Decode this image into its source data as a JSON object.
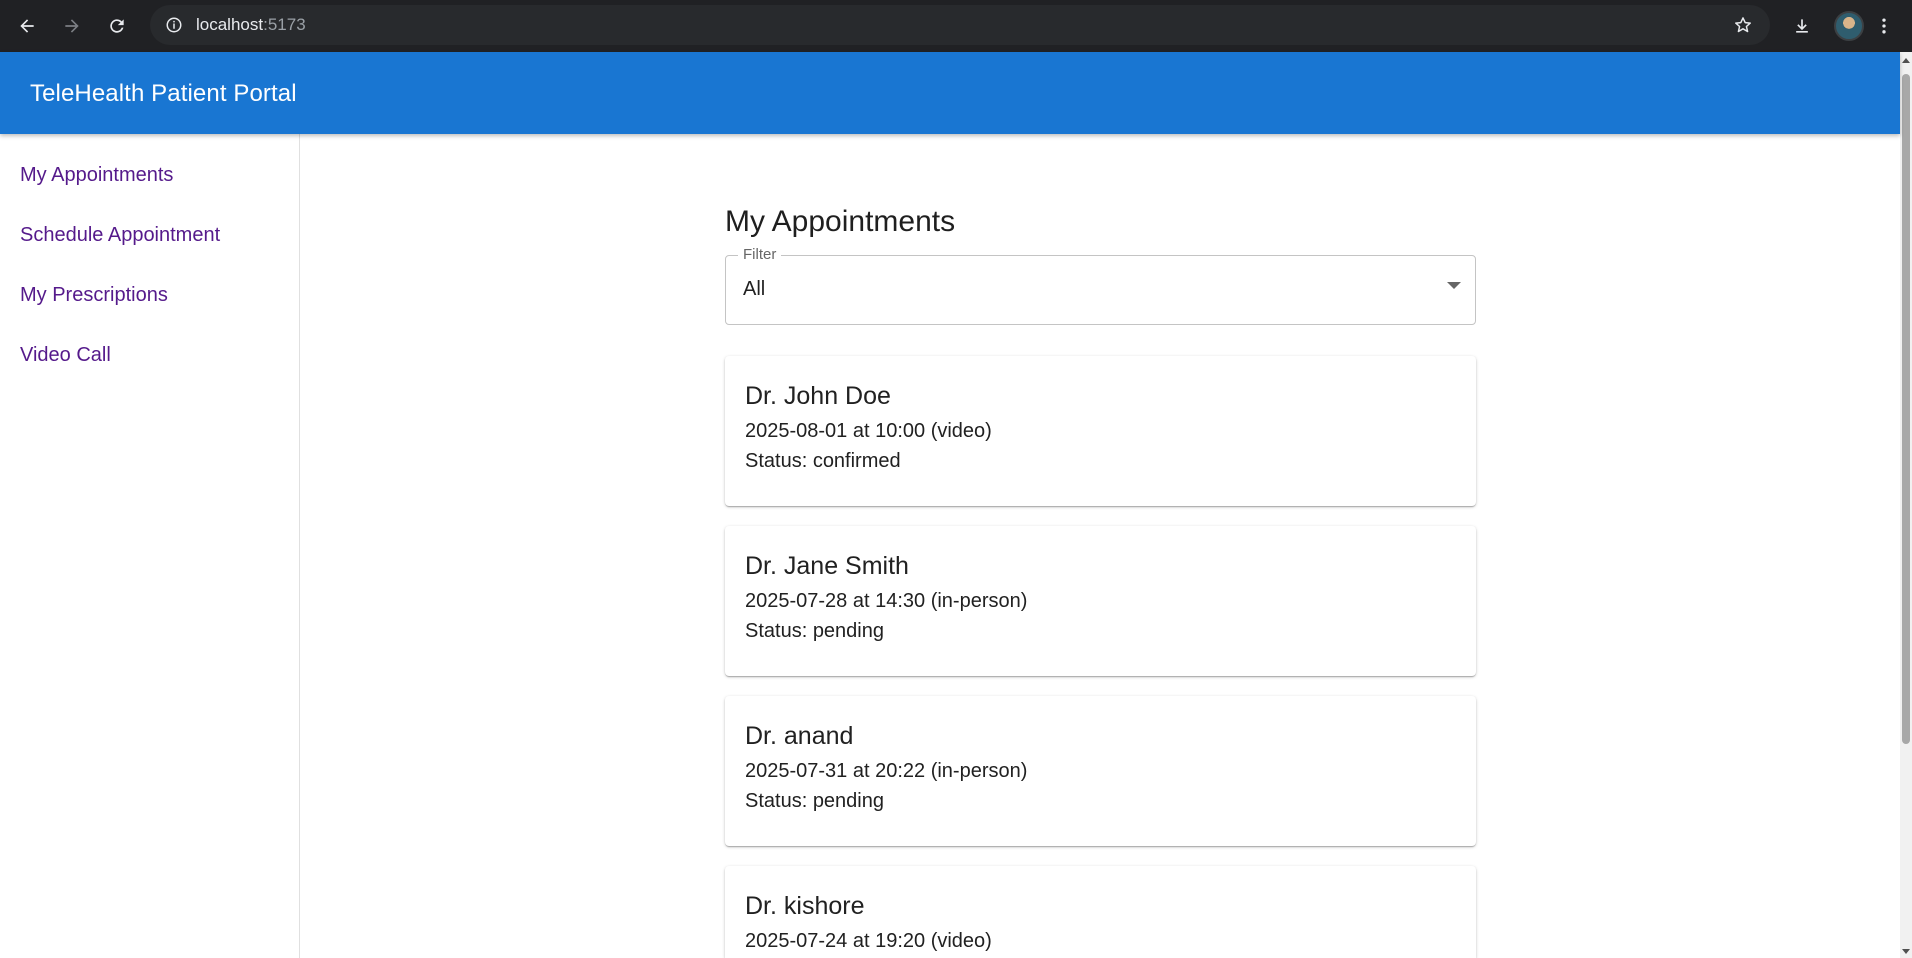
{
  "browser": {
    "url_host": "localhost",
    "url_port": ":5173",
    "icons": [
      "back-icon",
      "forward-icon",
      "reload-icon",
      "site-info-icon",
      "star-icon",
      "download-icon",
      "menu-icon"
    ]
  },
  "app": {
    "title": "TeleHealth Patient Portal",
    "accent_color": "#1976d2",
    "link_color": "#551a8b"
  },
  "sidebar": {
    "items": [
      {
        "label": "My Appointments"
      },
      {
        "label": "Schedule Appointment"
      },
      {
        "label": "My Prescriptions"
      },
      {
        "label": "Video Call"
      }
    ]
  },
  "main": {
    "title": "My Appointments",
    "filter": {
      "label": "Filter",
      "value": "All"
    },
    "appointments": [
      {
        "doctor": "Dr. John Doe",
        "when": "2025-08-01 at 10:00 (video)",
        "status": "Status: confirmed"
      },
      {
        "doctor": "Dr. Jane Smith",
        "when": "2025-07-28 at 14:30 (in-person)",
        "status": "Status: pending"
      },
      {
        "doctor": "Dr. anand",
        "when": "2025-07-31 at 20:22 (in-person)",
        "status": "Status: pending"
      },
      {
        "doctor": "Dr. kishore",
        "when": "2025-07-24 at 19:20 (video)",
        "status": ""
      }
    ]
  }
}
